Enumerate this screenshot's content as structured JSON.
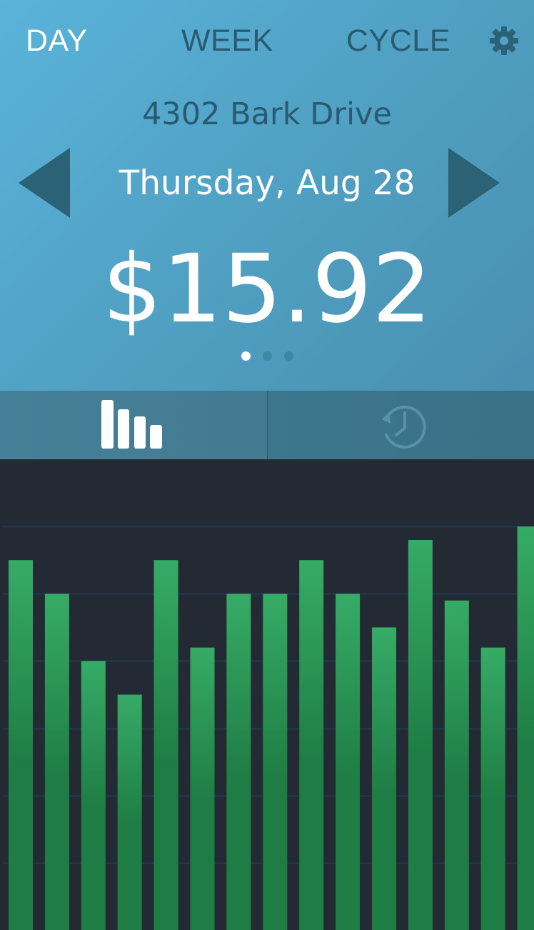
{
  "header": {
    "tabs": [
      {
        "label": "DAY",
        "active": true
      },
      {
        "label": "WEEK",
        "active": false
      },
      {
        "label": "CYCLE",
        "active": false
      }
    ],
    "settings_icon": "gear-icon",
    "address": "4302 Bark Drive",
    "date": "Thursday, Aug 28",
    "prev_icon": "triangle-left-icon",
    "next_icon": "triangle-right-icon",
    "amount": "$15.92",
    "pager": {
      "count": 3,
      "active_index": 0
    }
  },
  "view_toggle": {
    "items": [
      {
        "icon": "bar-chart-icon",
        "active": true
      },
      {
        "icon": "history-clock-icon",
        "active": false
      }
    ]
  },
  "colors": {
    "header_bg": "#5ab3da",
    "inactive_text": "#2a5a70",
    "arrow": "#2b6275",
    "chart_bg": "#232a33",
    "bar_top": "#36ab66",
    "bar_bottom": "#1e7d44",
    "gridline": "#1e3a52"
  },
  "chart_data": {
    "type": "bar",
    "values": [
      11,
      10,
      8,
      7,
      11,
      8.4,
      10,
      10,
      11,
      10,
      9,
      11.6,
      9.8,
      8.4,
      12
    ],
    "ylim": [
      0,
      14
    ],
    "grid": true
  }
}
